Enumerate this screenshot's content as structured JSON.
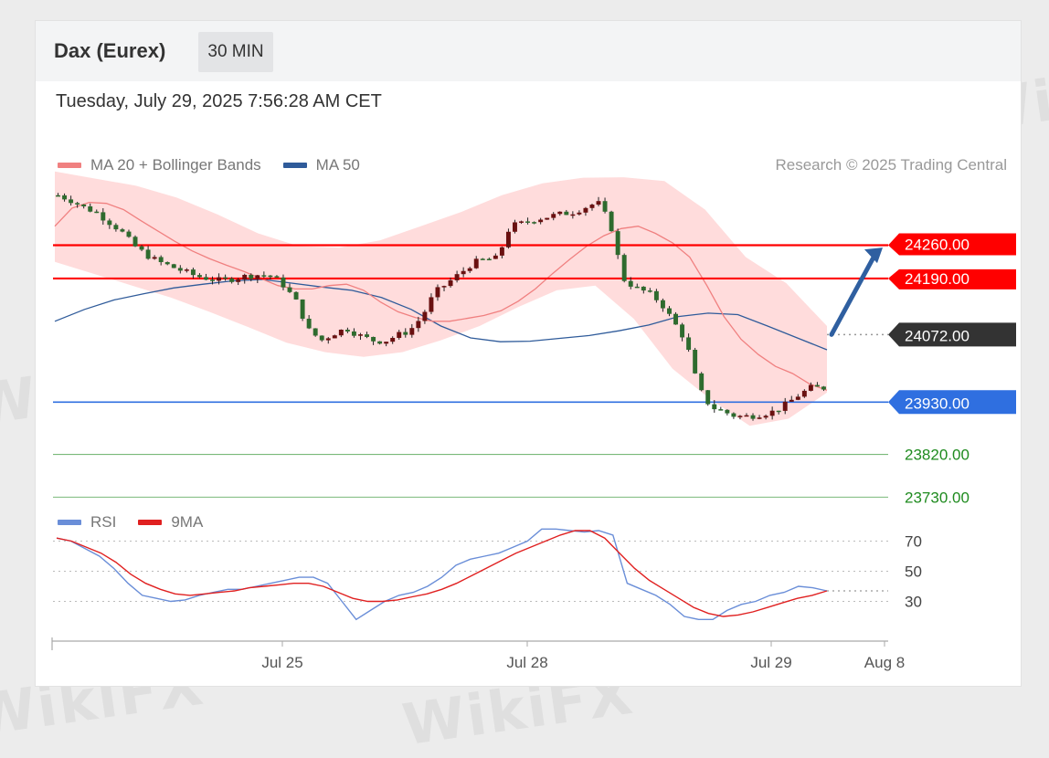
{
  "header": {
    "instrument": "Dax (Eurex)",
    "interval": "30 MIN",
    "timestamp": "Tuesday, July 29, 2025 7:56:28 AM CET"
  },
  "legend": {
    "items": [
      {
        "label": "MA 20 + Bollinger Bands",
        "color": "#f08080"
      },
      {
        "label": "MA 50",
        "color": "#2f5b9a"
      }
    ],
    "copyright": "Research © 2025 Trading Central"
  },
  "rsi_legend": {
    "items": [
      {
        "label": "RSI",
        "color": "#6a8ed8"
      },
      {
        "label": "9MA",
        "color": "#e02020"
      }
    ]
  },
  "watermark": "WikiFX",
  "colors": {
    "resistance": "#ff0000",
    "current": "#333333",
    "pivot": "#2f6fe0",
    "support": "#1f8b1f",
    "band_fill": "#ffd6d6",
    "candle_up": "#6a1010",
    "candle_down": "#2e6b2e"
  },
  "chart_data": [
    {
      "type": "candlestick",
      "title": "Dax (Eurex) 30 MIN",
      "x_ticks": [
        "Jul 25",
        "Jul 28",
        "Jul 29",
        "Aug 8"
      ],
      "ylim": [
        23700,
        24430
      ],
      "levels": [
        {
          "value": 24260.0,
          "label": "24260.00",
          "kind": "resistance"
        },
        {
          "value": 24190.0,
          "label": "24190.00",
          "kind": "resistance"
        },
        {
          "value": 24072.0,
          "label": "24072.00",
          "kind": "current"
        },
        {
          "value": 23930.0,
          "label": "23930.00",
          "kind": "pivot"
        },
        {
          "value": 23820.0,
          "label": "23820.00",
          "kind": "support"
        },
        {
          "value": 23730.0,
          "label": "23730.00",
          "kind": "support"
        }
      ],
      "price_path": [
        24365,
        24355,
        24340,
        24330,
        24310,
        24290,
        24260,
        24240,
        24225,
        24215,
        24205,
        24195,
        24190,
        24185,
        24190,
        24195,
        24198,
        24195,
        24175,
        24140,
        24080,
        24060,
        24075,
        24085,
        24070,
        24060,
        24058,
        24070,
        24080,
        24110,
        24160,
        24180,
        24200,
        24222,
        24230,
        24232,
        24300,
        24306,
        24315,
        24320,
        24325,
        24330,
        24340,
        24350,
        24305,
        24190,
        24170,
        24160,
        24140,
        24100,
        24060,
        23960,
        23920,
        23910,
        23900,
        23900,
        23905,
        23910,
        23925,
        23945,
        23960,
        23960
      ],
      "ma20": [
        24300,
        24338,
        24350,
        24348,
        24335,
        24312,
        24290,
        24268,
        24248,
        24232,
        24218,
        24205,
        24190,
        24175,
        24168,
        24168,
        24175,
        24178,
        24165,
        24140,
        24120,
        24108,
        24100,
        24100,
        24106,
        24112,
        24122,
        24142,
        24168,
        24200,
        24230,
        24258,
        24280,
        24295,
        24300,
        24285,
        24265,
        24235,
        24175,
        24110,
        24062,
        24030,
        24005,
        23990,
        23968,
        23955
      ],
      "ma50": [
        24100,
        24125,
        24145,
        24158,
        24170,
        24178,
        24185,
        24188,
        24180,
        24172,
        24165,
        24150,
        24125,
        24090,
        24065,
        24057,
        24058,
        24064,
        24070,
        24080,
        24092,
        24110,
        24117,
        24114,
        24090,
        24065,
        24040
      ],
      "bollinger_upper": [
        24415,
        24400,
        24385,
        24360,
        24325,
        24285,
        24258,
        24255,
        24270,
        24300,
        24330,
        24365,
        24390,
        24402,
        24403,
        24395,
        24335,
        24235,
        24180,
        24090
      ],
      "bollinger_lower": [
        24225,
        24200,
        24175,
        24150,
        24120,
        24088,
        24055,
        24035,
        24025,
        24035,
        24060,
        24090,
        24130,
        24165,
        24175,
        24105,
        24000,
        23935,
        23880,
        23895,
        23950
      ],
      "forecast_arrow": {
        "from": 24072,
        "to": 24255
      }
    },
    {
      "type": "line",
      "title": "RSI",
      "ylim": [
        0,
        100
      ],
      "y_ticks": [
        70,
        50,
        30
      ],
      "series": [
        {
          "name": "RSI",
          "values": [
            72,
            70,
            65,
            60,
            52,
            42,
            34,
            32,
            30,
            31,
            34,
            36,
            38,
            38,
            40,
            42,
            44,
            46,
            46,
            42,
            30,
            18,
            24,
            30,
            34,
            36,
            40,
            46,
            54,
            58,
            60,
            62,
            66,
            70,
            78,
            78,
            77,
            76,
            77,
            74,
            42,
            38,
            34,
            28,
            20,
            18,
            18,
            24,
            28,
            30,
            34,
            36,
            40,
            39,
            37
          ]
        },
        {
          "name": "9MA",
          "values": [
            72,
            70,
            66,
            62,
            56,
            48,
            42,
            38,
            35,
            34,
            35,
            36,
            37,
            39,
            40,
            41,
            42,
            42,
            40,
            36,
            32,
            30,
            30,
            31,
            33,
            35,
            38,
            42,
            47,
            52,
            57,
            62,
            66,
            70,
            74,
            77,
            77,
            72,
            62,
            52,
            44,
            38,
            32,
            26,
            22,
            20,
            21,
            23,
            26,
            29,
            32,
            34,
            37
          ]
        }
      ],
      "current_value": 37
    }
  ]
}
